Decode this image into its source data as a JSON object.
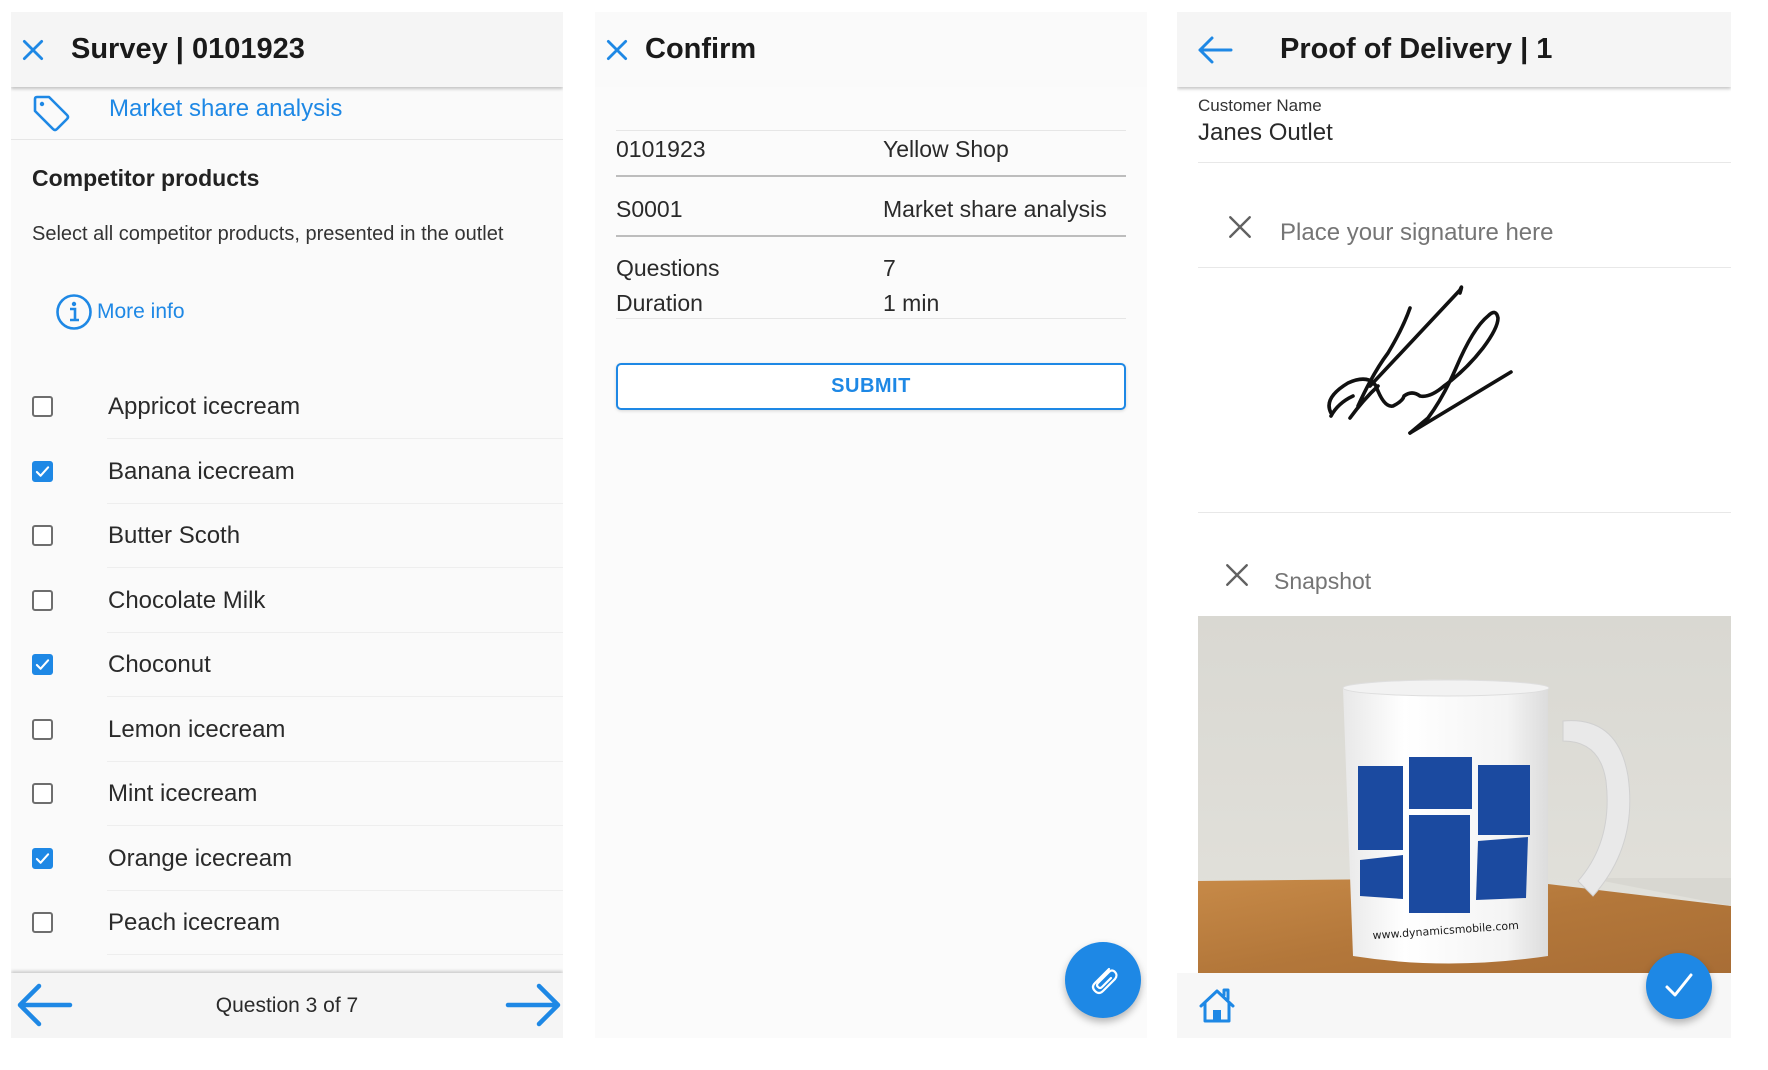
{
  "colors": {
    "accent": "#1e88e5",
    "text": "#212121",
    "muted": "#757575",
    "appbar": "#f5f5f5"
  },
  "survey": {
    "title": "Survey | 0101923",
    "close_icon": "close-icon",
    "tag_icon": "tag-icon",
    "survey_name": "Market share analysis",
    "question_title": "Competitor products",
    "question_text": "Select all competitor products, presented in the outlet",
    "more_info_icon": "info-icon",
    "more_info_label": "More info",
    "options": [
      {
        "label": "Appricot icecream",
        "checked": false
      },
      {
        "label": "Banana icecream",
        "checked": true
      },
      {
        "label": "Butter Scoth",
        "checked": false
      },
      {
        "label": "Chocolate Milk",
        "checked": false
      },
      {
        "label": "Choconut",
        "checked": true
      },
      {
        "label": "Lemon icecream",
        "checked": false
      },
      {
        "label": "Mint icecream",
        "checked": false
      },
      {
        "label": "Orange icecream",
        "checked": true
      },
      {
        "label": "Peach icecream",
        "checked": false
      }
    ],
    "pager": {
      "label": "Question 3 of 7",
      "current": 3,
      "total": 7,
      "prev_icon": "arrow-left-icon",
      "next_icon": "arrow-right-icon"
    }
  },
  "confirm": {
    "title": "Confirm",
    "close_icon": "close-icon",
    "rows": [
      {
        "key": "0101923",
        "value": "Yellow Shop"
      },
      {
        "key": "S0001",
        "value": "Market share analysis"
      },
      {
        "key": "Questions",
        "value": "7"
      },
      {
        "key": "Duration",
        "value": "1 min"
      }
    ],
    "submit_label": "SUBMIT",
    "fab_icon": "paperclip-icon"
  },
  "pod": {
    "title": "Proof of Delivery | 1",
    "back_icon": "arrow-left-icon",
    "customer_label": "Customer Name",
    "customer_value": "Janes Outlet",
    "signature_placeholder": "Place your signature here",
    "signature_clear_icon": "close-icon",
    "snapshot_label": "Snapshot",
    "snapshot_clear_icon": "close-icon",
    "mug_text": "www.dynamicsmobile.com",
    "home_icon": "home-icon",
    "confirm_fab_icon": "check-icon"
  }
}
